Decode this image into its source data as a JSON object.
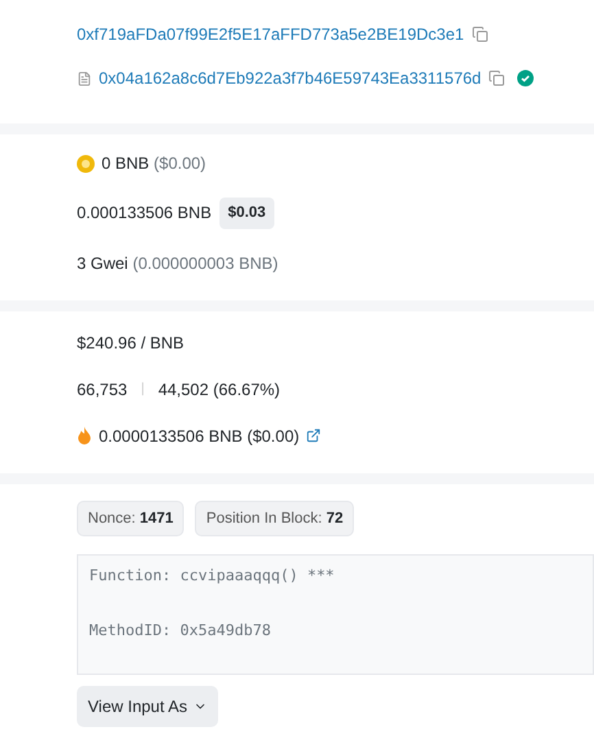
{
  "addresses": {
    "from": "0xf719aFDa07f99E2f5E17aFFD773a5e2BE19Dc3e1",
    "to": "0x04a162a8c6d7Eb922a3f7b46E59743Ea3311576d",
    "verified": true
  },
  "value": {
    "amount": "0 BNB",
    "usd": "($0.00)"
  },
  "fee": {
    "amount": "0.000133506 BNB",
    "usd": "$0.03"
  },
  "gas_price": {
    "amount": "3 Gwei",
    "bnb": "(0.000000003 BNB)"
  },
  "price": "$240.96 / BNB",
  "gas": {
    "limit": "66,753",
    "separator": "|",
    "used": "44,502 (66.67%)"
  },
  "burnt": "0.0000133506 BNB ($0.00)",
  "badges": [
    {
      "label": "Nonce:",
      "value": "1471"
    },
    {
      "label": "Position In Block:",
      "value": "72"
    }
  ],
  "input_lines": [
    "Function: ccvipaaaqqq() ***",
    "MethodID: 0x5a49db78"
  ],
  "view_button": "View Input As"
}
